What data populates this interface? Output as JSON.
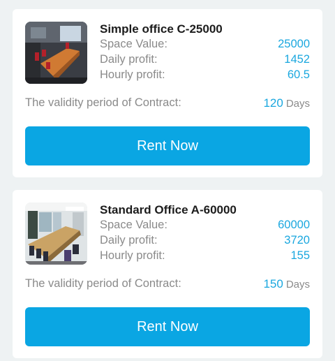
{
  "offers": [
    {
      "title": "Simple office C-25000",
      "space_value_label": "Space Value:",
      "space_value": "25000",
      "daily_profit_label": "Daily profit:",
      "daily_profit": "1452",
      "hourly_profit_label": "Hourly profit:",
      "hourly_profit": "60.5",
      "validity_label": "The validity period of Contract:",
      "validity_days": "120",
      "days_unit": "Days",
      "button_label": "Rent Now",
      "image_icon": "office-photo-icon"
    },
    {
      "title": "Standard Office A-60000",
      "space_value_label": "Space Value:",
      "space_value": "60000",
      "daily_profit_label": "Daily profit:",
      "daily_profit": "3720",
      "hourly_profit_label": "Hourly profit:",
      "hourly_profit": "155",
      "validity_label": "The validity period of Contract:",
      "validity_days": "150",
      "days_unit": "Days",
      "button_label": "Rent Now",
      "image_icon": "office-photo-icon"
    }
  ],
  "colors": {
    "accent": "#0aa6e3",
    "value_text": "#1aa7df",
    "label_text": "#8a8a8a",
    "background": "#eef2f3"
  }
}
